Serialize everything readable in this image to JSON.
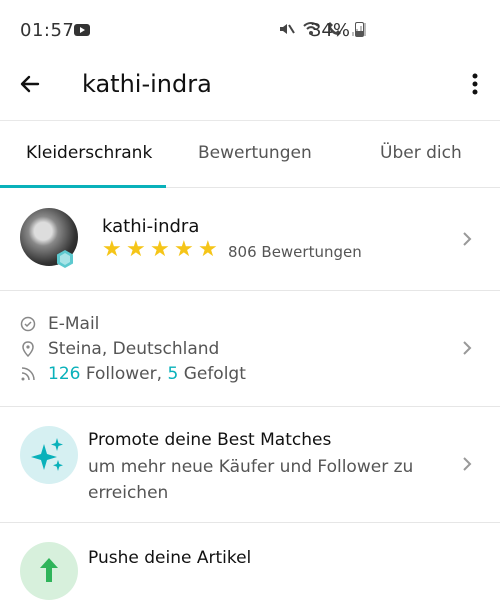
{
  "status": {
    "time": "01:57",
    "battery": "34%"
  },
  "appbar": {
    "title": "kathi-indra"
  },
  "tabs": [
    {
      "label": "Kleiderschrank"
    },
    {
      "label": "Bewertungen"
    },
    {
      "label": "Über dich"
    }
  ],
  "profile": {
    "name": "kathi-indra",
    "reviews": "806 Bewertungen",
    "rating": 5
  },
  "info": {
    "email": "E-Mail",
    "location": "Steina, Deutschland",
    "followers_count": "126",
    "followers_label": "Follower,",
    "following_count": "5",
    "following_label": "Gefolgt"
  },
  "promo": {
    "title": "Promote deine Best Matches",
    "subtitle": "um mehr neue Käufer und Follower zu erreichen"
  },
  "push": {
    "title": "Pushe deine Artikel"
  },
  "colors": {
    "accent": "#09b1ba",
    "star": "#f5c518"
  }
}
